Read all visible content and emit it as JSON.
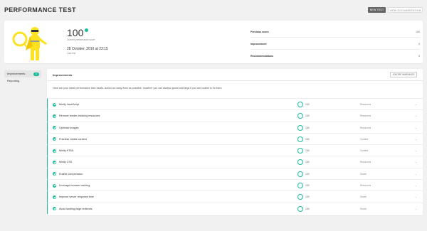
{
  "header": {
    "title": "PERFORMANCE TEST",
    "new_test_label": "NEW TEST",
    "docs_label": "VIEW DOCUMENTATION"
  },
  "summary": {
    "score": "100",
    "score_label": "Current performance score",
    "date": "28 October, 2016 at 22:15",
    "date_label": "Last test",
    "stats": [
      {
        "label": "Previous score",
        "value": "100"
      },
      {
        "label": "Improvement",
        "value": "0"
      },
      {
        "label": "Recommendations",
        "value": "0"
      }
    ]
  },
  "sidebar": {
    "items": [
      {
        "label": "Improvements",
        "badge": "0",
        "active": true
      },
      {
        "label": "Reporting",
        "badge": "",
        "active": false
      }
    ]
  },
  "panel": {
    "title": "Improvements",
    "ignore_label": "IGNORE WARNINGS",
    "intro": "Here are your latest performance test results. Action as many fixes as possible, however you can always ignore warnings if you are unable to fix them.",
    "rows": [
      {
        "name": "Minify JavaScript",
        "score": "100",
        "type": "Resources"
      },
      {
        "name": "Remove render-blocking resources",
        "score": "100",
        "type": "Resources"
      },
      {
        "name": "Optimize images",
        "score": "100",
        "type": "Resources"
      },
      {
        "name": "Prioritize visible content",
        "score": "100",
        "type": "Content"
      },
      {
        "name": "Minify HTML",
        "score": "100",
        "type": "Content"
      },
      {
        "name": "Minify CSS",
        "score": "100",
        "type": "Resources"
      },
      {
        "name": "Enable compression",
        "score": "100",
        "type": "Server"
      },
      {
        "name": "Leverage browser caching",
        "score": "100",
        "type": "Resources"
      },
      {
        "name": "Improve server response time",
        "score": "100",
        "type": "Server"
      },
      {
        "name": "Avoid landing page redirects",
        "score": "100",
        "type": "Server"
      }
    ]
  },
  "colors": {
    "accent": "#1abc9c",
    "mascot": "#ffe21f"
  }
}
